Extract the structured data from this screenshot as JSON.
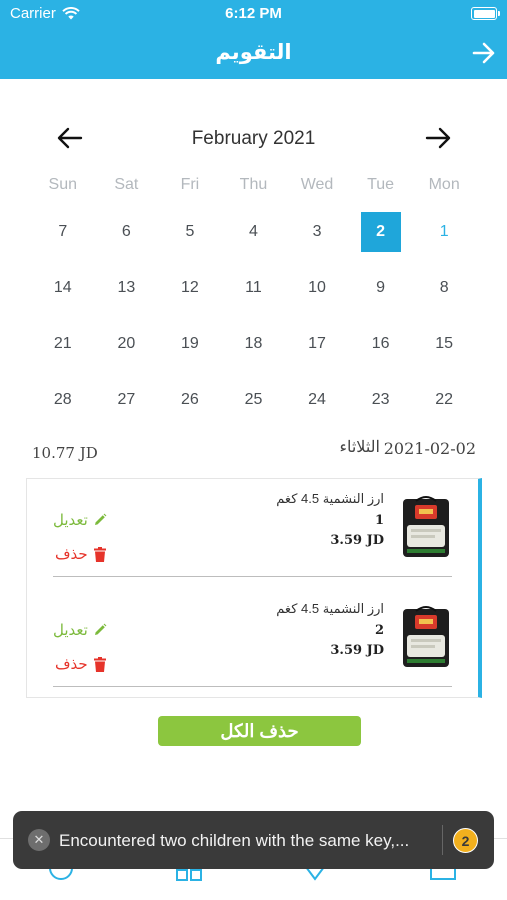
{
  "status_bar": {
    "carrier": "Carrier",
    "time": "6:12 PM"
  },
  "header": {
    "title": "التقويم"
  },
  "calendar": {
    "month": "February 2021",
    "weekdays": [
      "Sun",
      "Sat",
      "Fri",
      "Thu",
      "Wed",
      "Tue",
      "Mon"
    ],
    "rows": [
      [
        "7",
        "6",
        "5",
        "4",
        "3",
        "2",
        "1"
      ],
      [
        "14",
        "13",
        "12",
        "11",
        "10",
        "9",
        "8"
      ],
      [
        "21",
        "20",
        "19",
        "18",
        "17",
        "16",
        "15"
      ],
      [
        "28",
        "27",
        "26",
        "25",
        "24",
        "23",
        "22"
      ]
    ],
    "selected_day": "2",
    "today_day": "1"
  },
  "summary": {
    "total": "10.77 JD",
    "day_name": "الثلاثاء",
    "date": "2021-02-02"
  },
  "orders": [
    {
      "name": "ارز النشمية 4.5 كغم",
      "quantity": "1",
      "price": "3.59 JD",
      "edit_label": "تعديل",
      "delete_label": "حذف"
    },
    {
      "name": "ارز النشمية 4.5 كغم",
      "quantity": "2",
      "price": "3.59 JD",
      "edit_label": "تعديل",
      "delete_label": "حذف"
    }
  ],
  "delete_all_label": "حذف الكل",
  "toast": {
    "message": "Encountered two children with the same key,...",
    "count": "2"
  },
  "colors": {
    "primary": "#2bb2e4",
    "edit": "#7cba3c",
    "delete": "#e6332a",
    "button": "#8cc63f"
  }
}
